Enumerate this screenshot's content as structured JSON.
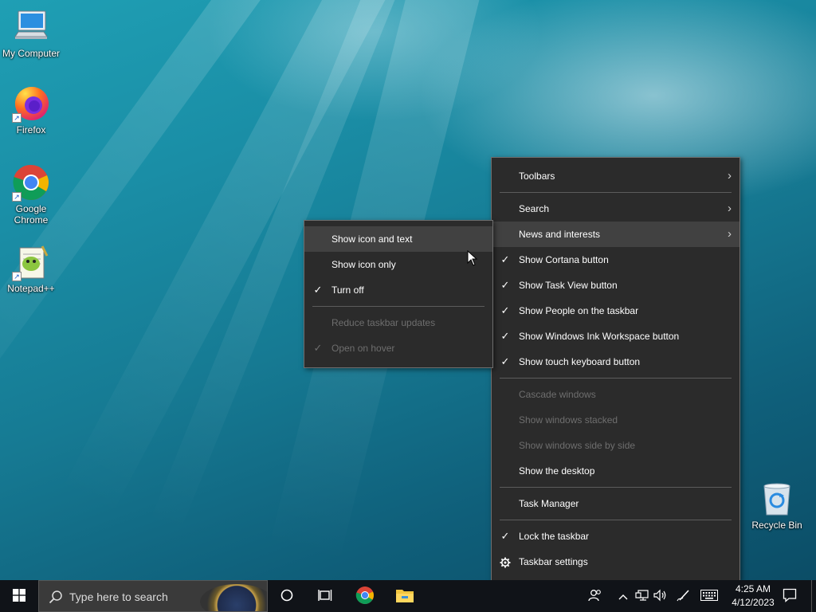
{
  "desktop": {
    "icons": [
      {
        "label": "My Computer",
        "icon": "computer-icon"
      },
      {
        "label": "Firefox",
        "icon": "firefox-icon"
      },
      {
        "label": "Google Chrome",
        "icon": "chrome-icon"
      },
      {
        "label": "Notepad++",
        "icon": "notepadpp-icon"
      },
      {
        "label": "Recycle Bin",
        "icon": "recycle-bin-icon"
      }
    ]
  },
  "main_menu": {
    "items": [
      {
        "label": "Toolbars",
        "checked": false,
        "disabled": false,
        "submenu": true
      },
      {
        "label": "Search",
        "checked": false,
        "disabled": false,
        "submenu": true
      },
      {
        "label": "News and interests",
        "checked": false,
        "disabled": false,
        "submenu": true,
        "highlighted": true
      },
      {
        "label": "Show Cortana button",
        "checked": true,
        "disabled": false
      },
      {
        "label": "Show Task View button",
        "checked": true,
        "disabled": false
      },
      {
        "label": "Show People on the taskbar",
        "checked": true,
        "disabled": false
      },
      {
        "label": "Show Windows Ink Workspace button",
        "checked": true,
        "disabled": false
      },
      {
        "label": "Show touch keyboard button",
        "checked": true,
        "disabled": false
      },
      {
        "label": "Cascade windows",
        "checked": false,
        "disabled": true
      },
      {
        "label": "Show windows stacked",
        "checked": false,
        "disabled": true
      },
      {
        "label": "Show windows side by side",
        "checked": false,
        "disabled": true
      },
      {
        "label": "Show the desktop",
        "checked": false,
        "disabled": false
      },
      {
        "label": "Task Manager",
        "checked": false,
        "disabled": false
      },
      {
        "label": "Lock the taskbar",
        "checked": true,
        "disabled": false
      },
      {
        "label": "Taskbar settings",
        "checked": false,
        "disabled": false,
        "icon": "gear-icon"
      }
    ]
  },
  "news_submenu": {
    "items": [
      {
        "label": "Show icon and text",
        "checked": false,
        "disabled": false,
        "highlighted": true
      },
      {
        "label": "Show icon only",
        "checked": false,
        "disabled": false
      },
      {
        "label": "Turn off",
        "checked": true,
        "disabled": false
      },
      {
        "label": "Reduce taskbar updates",
        "checked": false,
        "disabled": true
      },
      {
        "label": "Open on hover",
        "checked": true,
        "disabled": true
      }
    ]
  },
  "taskbar": {
    "search_placeholder": "Type here to search",
    "clock_time": "4:25 AM",
    "clock_date": "4/12/2023",
    "pinned": [
      "chrome-icon",
      "file-explorer-icon"
    ]
  },
  "glyphs": {
    "check": "✓",
    "arrow": "›"
  }
}
